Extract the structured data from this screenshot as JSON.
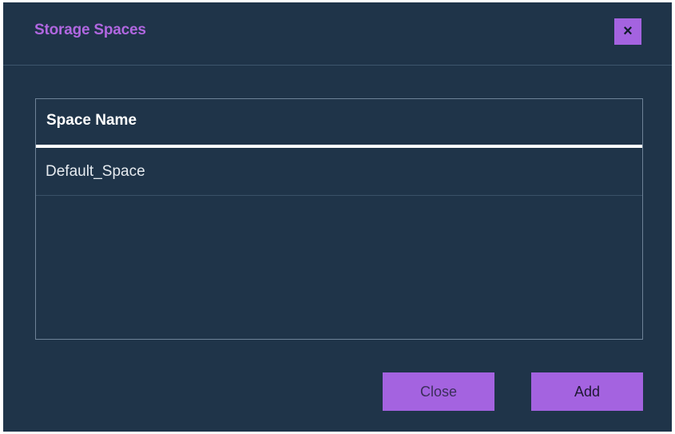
{
  "dialog": {
    "title": "Storage Spaces",
    "close_icon": "×",
    "accent_color": "#a463e0",
    "background_color": "#1f3449"
  },
  "table": {
    "header": "Space Name",
    "rows": [
      {
        "label": "Default_Space"
      }
    ]
  },
  "buttons": {
    "close_label": "Close",
    "add_label": "Add"
  }
}
